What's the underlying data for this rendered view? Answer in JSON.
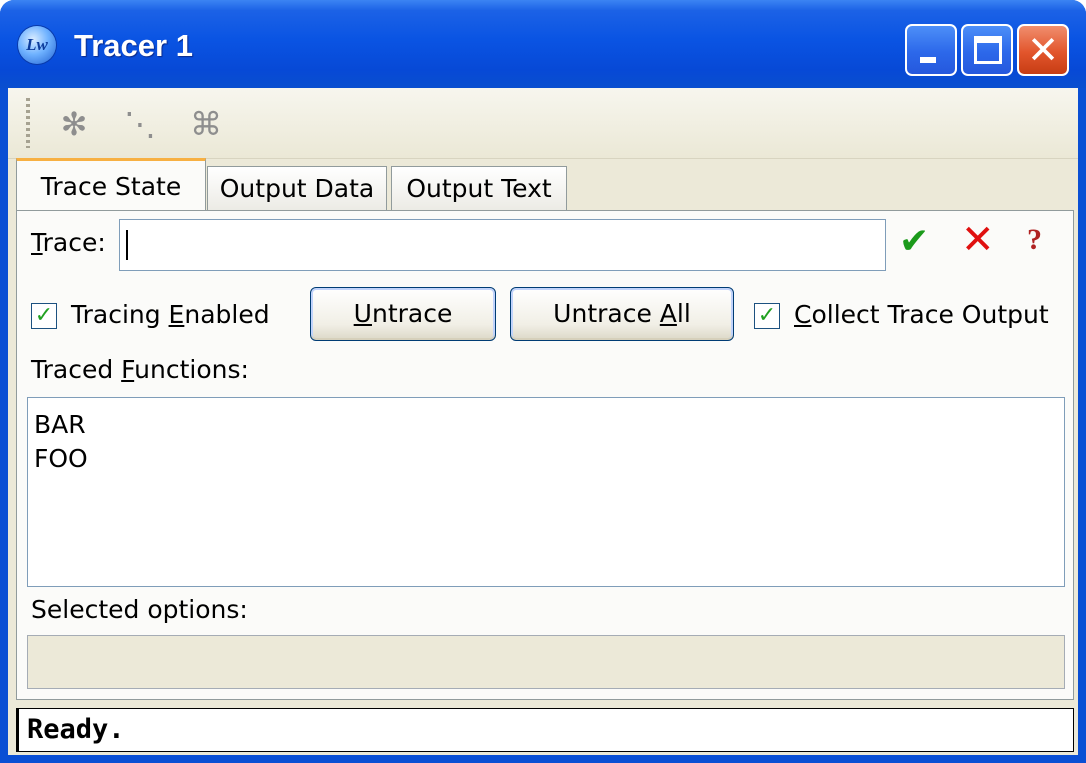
{
  "window": {
    "title": "Tracer 1",
    "app_icon_text": "Lw"
  },
  "toolbar": {
    "icons": [
      "untrace-all-icon",
      "trace-icon",
      "toggle-trace-icon"
    ]
  },
  "tabs": [
    {
      "label": "Trace State",
      "active": true
    },
    {
      "label": "Output Data",
      "active": false
    },
    {
      "label": "Output Text",
      "active": false
    }
  ],
  "trace_state": {
    "trace_label_first": "T",
    "trace_label_rest": "race:",
    "trace_input_value": "",
    "tracing_enabled": {
      "pre": "Tracing ",
      "key": "E",
      "post": "nabled",
      "checked": true
    },
    "untrace_button": {
      "pre": "",
      "key": "U",
      "post": "ntrace"
    },
    "untrace_all_button": {
      "pre": "Untrace ",
      "key": "A",
      "post": "ll"
    },
    "collect_trace_output": {
      "pre": "",
      "key": "C",
      "post": "ollect Trace Output",
      "checked": true
    },
    "traced_functions_label": {
      "pre": "Traced ",
      "key": "F",
      "post": "unctions:"
    },
    "traced_functions": [
      "BAR",
      "FOO"
    ],
    "selected_options_label": "Selected options:",
    "selected_options_value": ""
  },
  "status": {
    "text": "Ready."
  },
  "colors": {
    "title_bar": "#0a54e3",
    "face": "#ece9d8",
    "active_tab_accent": "#f7b042",
    "ok_green": "#1b9a1b",
    "cancel_red": "#e0100f"
  }
}
